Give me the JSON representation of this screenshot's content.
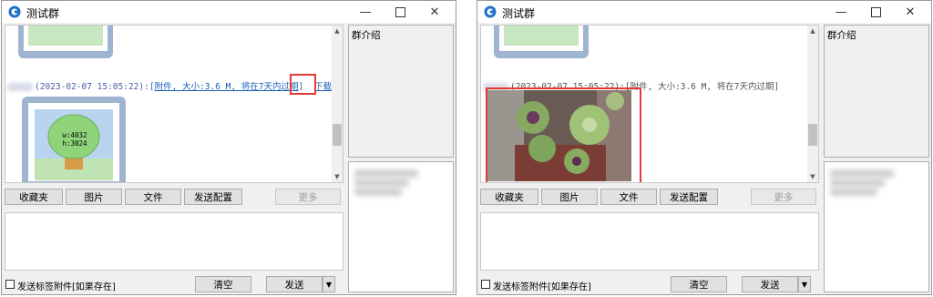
{
  "windows": [
    {
      "title": "测试群",
      "message": {
        "timestamp": "(2023-02-07 15:05:22):",
        "bracket_open": "[",
        "attachment_text": "附件, 大小:3.6 M, 将在7天内过期",
        "bracket_close": "]",
        "download_link": "下载"
      },
      "placeholder_image": {
        "width_label": "w:4032",
        "height_label": "h:3024"
      },
      "toolbar": {
        "favorites": "收藏夹",
        "picture": "图片",
        "file": "文件",
        "send_config": "发送配置",
        "more": "更多"
      },
      "checkbox_label": "发送标签附件[如果存在]",
      "clear_button": "清空",
      "send_button": "发送",
      "group_intro_label": "群介绍"
    },
    {
      "title": "测试群",
      "message": {
        "timestamp": "(2023-02-07 15:05:22):",
        "bracket_open": "[",
        "attachment_text": "附件, 大小:3.6 M, 将在7天内过期",
        "bracket_close": "]"
      },
      "toolbar": {
        "favorites": "收藏夹",
        "picture": "图片",
        "file": "文件",
        "send_config": "发送配置",
        "more": "更多"
      },
      "checkbox_label": "发送标签附件[如果存在]",
      "clear_button": "清空",
      "send_button": "发送",
      "group_intro_label": "群介绍"
    }
  ],
  "icons": {
    "minimize": "minimize-icon",
    "maximize": "maximize-icon",
    "close": "close-icon",
    "app": "app-logo-icon",
    "send_dropdown": "caret-down-icon"
  },
  "colors": {
    "highlight_box": "#e53935",
    "link": "#1a5fb4",
    "image_frame": "#9fb4d0"
  }
}
